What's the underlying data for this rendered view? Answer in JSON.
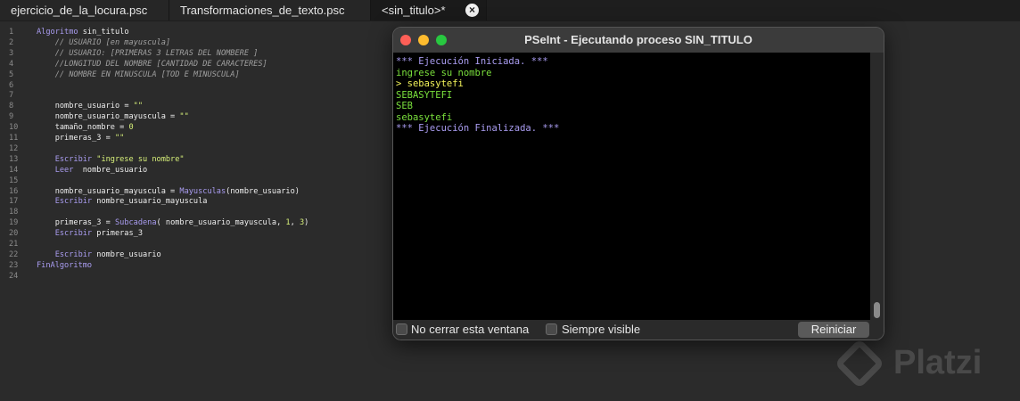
{
  "tabs": [
    {
      "label": "ejercicio_de_la_locura.psc"
    },
    {
      "label": "Transformaciones_de_texto.psc"
    },
    {
      "label": "<sin_titulo>*"
    }
  ],
  "code_lines": [
    {
      "n": "1",
      "parts": [
        {
          "t": "Algoritmo ",
          "c": "kw"
        },
        {
          "t": "sin_titulo",
          "c": "tx"
        }
      ]
    },
    {
      "n": "2",
      "parts": [
        {
          "t": "    // USUARIO [en mayuscula]",
          "c": "cm"
        }
      ]
    },
    {
      "n": "3",
      "parts": [
        {
          "t": "    // USUARIO: [PRIMERAS 3 LETRAS DEL NOMBERE ]",
          "c": "cm"
        }
      ]
    },
    {
      "n": "4",
      "parts": [
        {
          "t": "    //LONGITUD DEL NOMBRE [CANTIDAD DE CARACTERES]",
          "c": "cm"
        }
      ]
    },
    {
      "n": "5",
      "parts": [
        {
          "t": "    // NOMBRE EN MINUSCULA [TOD E MINUSCULA]",
          "c": "cm"
        }
      ]
    },
    {
      "n": "6",
      "parts": []
    },
    {
      "n": "7",
      "parts": []
    },
    {
      "n": "8",
      "parts": [
        {
          "t": "    nombre_usuario ",
          "c": "tx"
        },
        {
          "t": "= ",
          "c": "op"
        },
        {
          "t": "\"\"",
          "c": "st"
        }
      ]
    },
    {
      "n": "9",
      "parts": [
        {
          "t": "    nombre_usuario_mayuscula ",
          "c": "tx"
        },
        {
          "t": "= ",
          "c": "op"
        },
        {
          "t": "\"\"",
          "c": "st"
        }
      ]
    },
    {
      "n": "10",
      "parts": [
        {
          "t": "    tamaño_nombre ",
          "c": "tx"
        },
        {
          "t": "= ",
          "c": "op"
        },
        {
          "t": "0",
          "c": "nm"
        }
      ]
    },
    {
      "n": "11",
      "parts": [
        {
          "t": "    primeras_3 ",
          "c": "tx"
        },
        {
          "t": "= ",
          "c": "op"
        },
        {
          "t": "\"\"",
          "c": "st"
        }
      ]
    },
    {
      "n": "12",
      "parts": []
    },
    {
      "n": "13",
      "parts": [
        {
          "t": "    Escribir ",
          "c": "kw"
        },
        {
          "t": "\"ingrese su nombre\"",
          "c": "st"
        }
      ]
    },
    {
      "n": "14",
      "parts": [
        {
          "t": "    Leer ",
          "c": "kw"
        },
        {
          "t": " nombre_usuario",
          "c": "tx"
        }
      ]
    },
    {
      "n": "15",
      "parts": []
    },
    {
      "n": "16",
      "parts": [
        {
          "t": "    nombre_usuario_mayuscula ",
          "c": "tx"
        },
        {
          "t": "= ",
          "c": "op"
        },
        {
          "t": "Mayusculas",
          "c": "fn"
        },
        {
          "t": "(nombre_usuario)",
          "c": "tx"
        }
      ]
    },
    {
      "n": "17",
      "parts": [
        {
          "t": "    Escribir ",
          "c": "kw"
        },
        {
          "t": "nombre_usuario_mayuscula",
          "c": "tx"
        }
      ]
    },
    {
      "n": "18",
      "parts": []
    },
    {
      "n": "19",
      "parts": [
        {
          "t": "    primeras_3 ",
          "c": "tx"
        },
        {
          "t": "= ",
          "c": "op"
        },
        {
          "t": "Subcadena",
          "c": "fn"
        },
        {
          "t": "( nombre_usuario_mayuscula, ",
          "c": "tx"
        },
        {
          "t": "1",
          "c": "nm"
        },
        {
          "t": ", ",
          "c": "tx"
        },
        {
          "t": "3",
          "c": "nm"
        },
        {
          "t": ")",
          "c": "tx"
        }
      ]
    },
    {
      "n": "20",
      "parts": [
        {
          "t": "    Escribir ",
          "c": "kw"
        },
        {
          "t": "primeras_3",
          "c": "tx"
        }
      ]
    },
    {
      "n": "21",
      "parts": []
    },
    {
      "n": "22",
      "parts": [
        {
          "t": "    Escribir ",
          "c": "kw"
        },
        {
          "t": "nombre_usuario",
          "c": "tx"
        }
      ]
    },
    {
      "n": "23",
      "parts": [
        {
          "t": "FinAlgoritmo",
          "c": "kw"
        }
      ]
    },
    {
      "n": "24",
      "parts": []
    }
  ],
  "exec_window": {
    "title": "PSeInt - Ejecutando proceso SIN_TITULO",
    "console": [
      {
        "text": "*** Ejecución Iniciada. ***",
        "color": "#a99cf0"
      },
      {
        "text": "ingrese su nombre",
        "color": "#7ae03c"
      },
      {
        "text": "> sebasytefi",
        "color": "#f2f25a"
      },
      {
        "text": "SEBASYTEFI",
        "color": "#7ae03c"
      },
      {
        "text": "SEB",
        "color": "#7ae03c"
      },
      {
        "text": "sebasytefi",
        "color": "#7ae03c"
      },
      {
        "text": "*** Ejecución Finalizada. ***",
        "color": "#a99cf0"
      }
    ],
    "no_close_label": "No cerrar esta ventana",
    "always_visible_label": "Siempre visible",
    "restart_label": "Reiniciar"
  },
  "watermark": {
    "text": "Platzi"
  },
  "colors": {
    "close": "#fe5f57",
    "minimize": "#febc2e",
    "maximize": "#28c840"
  }
}
